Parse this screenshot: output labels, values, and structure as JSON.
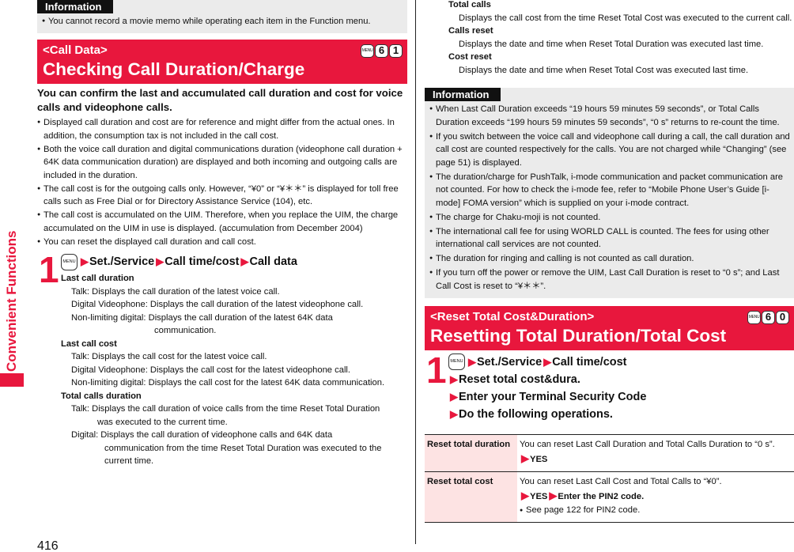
{
  "side_tab": {
    "label": "Convenient Functions"
  },
  "page_number": "416",
  "left": {
    "info_box": {
      "tag": "Information",
      "items": [
        "You cannot record a movie memo while operating each item in the Function menu."
      ]
    },
    "header": {
      "subtitle": "<Call Data>",
      "title": "Checking Call Duration/Charge",
      "keys": [
        "MENU",
        "6",
        "1"
      ]
    },
    "lead": "You can confirm the last and accumulated call duration and cost for voice calls and videophone calls.",
    "bullets": [
      "Displayed call duration and cost are for reference and might differ from the actual ones. In addition, the consumption tax is not included in the call cost.",
      "Both the voice call duration and digital communications duration (videophone call duration + 64K data communication duration) are displayed and both incoming and outgoing calls are included in the duration.",
      "The call cost is for the outgoing calls only. However, “¥0” or “¥＊＊” is displayed for toll free calls such as Free Dial or for Directory Assistance Service (104), etc.",
      "The call cost is accumulated on the UIM. Therefore, when you replace the UIM, the charge accumulated on the UIM in use is displayed. (accumulation from December 2004)",
      "You can reset the displayed call duration and call cost."
    ],
    "step": {
      "number": "1",
      "menu_key": "MENU",
      "path": [
        "Set./Service",
        "Call time/cost",
        "Call data"
      ],
      "definitions": {
        "last_call_duration": {
          "term": "Last call duration",
          "lines": [
            "Talk: Displays the call duration of the latest voice call.",
            "Digital Videophone: Displays the call duration of the latest videophone call.",
            "Non-limiting digital: Displays the call duration of the latest 64K data",
            "communication."
          ]
        },
        "last_call_cost": {
          "term": "Last call cost",
          "lines": [
            "Talk: Displays the call cost for the latest voice call.",
            "Digital Videophone: Displays the call cost for the latest videophone call.",
            "Non-limiting digital: Displays the call cost for the latest 64K data communication."
          ]
        },
        "total_calls_duration": {
          "term": "Total calls duration",
          "lines": [
            "Talk: Displays the call duration of voice calls from the time Reset Total Duration",
            "was executed to the current time.",
            "Digital: Displays the call duration of videophone calls and 64K data",
            "communication from the time Reset Total Duration was executed to the",
            "current time."
          ]
        }
      }
    }
  },
  "right": {
    "continued_defs": [
      {
        "term": "Total calls",
        "text": "Displays the call cost from the time Reset Total Cost was executed to the current call."
      },
      {
        "term": "Calls reset",
        "text": "Displays the date and time when Reset Total Duration was executed last time."
      },
      {
        "term": "Cost reset",
        "text": "Displays the date and time when Reset Total Cost was executed last time."
      }
    ],
    "info_box": {
      "tag": "Information",
      "items": [
        "When Last Call Duration exceeds “19 hours 59 minutes 59 seconds”, or Total Calls Duration exceeds “199 hours 59 minutes 59 seconds”, “0 s” returns to re-count the time.",
        "If you switch between the voice call and videophone call during a call, the call duration and call cost are counted respectively for the calls. You are not charged while “Changing” (see page 51) is displayed.",
        "The duration/charge for PushTalk, i-mode communication and packet communication are not counted. For how to check the i-mode fee, refer to “Mobile Phone User’s Guide [i-mode] FOMA version” which is supplied on your i-mode contract.",
        "The charge for Chaku-moji is not counted.",
        "The international call fee for using WORLD CALL is counted. The fees for using other international call services are not counted.",
        "The duration for ringing and calling is not counted as call duration.",
        "If you turn off the power or remove the UIM, Last Call Duration is reset to “0 s”; and Last Call Cost is reset to “¥＊＊”."
      ]
    },
    "header": {
      "subtitle": "<Reset Total Cost&Duration>",
      "title": "Resetting Total Duration/Total Cost",
      "keys": [
        "MENU",
        "6",
        "0"
      ]
    },
    "step": {
      "number": "1",
      "menu_key": "MENU",
      "lines": [
        [
          "Set./Service",
          "Call time/cost"
        ],
        [
          "Reset total cost&dura."
        ],
        [
          "Enter your Terminal Security Code"
        ],
        [
          "Do the following operations."
        ]
      ]
    },
    "table": {
      "rows": [
        {
          "term": "Reset total duration",
          "text": "You can reset Last Call Duration and Total Calls Duration to “0 s”.",
          "action": [
            "YES"
          ],
          "note": ""
        },
        {
          "term": "Reset total cost",
          "text": "You can reset Last Call Cost and Total Calls to “¥0”.",
          "action": [
            "YES",
            "Enter the PIN2 code."
          ],
          "note": "See page 122 for PIN2 code."
        }
      ]
    }
  }
}
